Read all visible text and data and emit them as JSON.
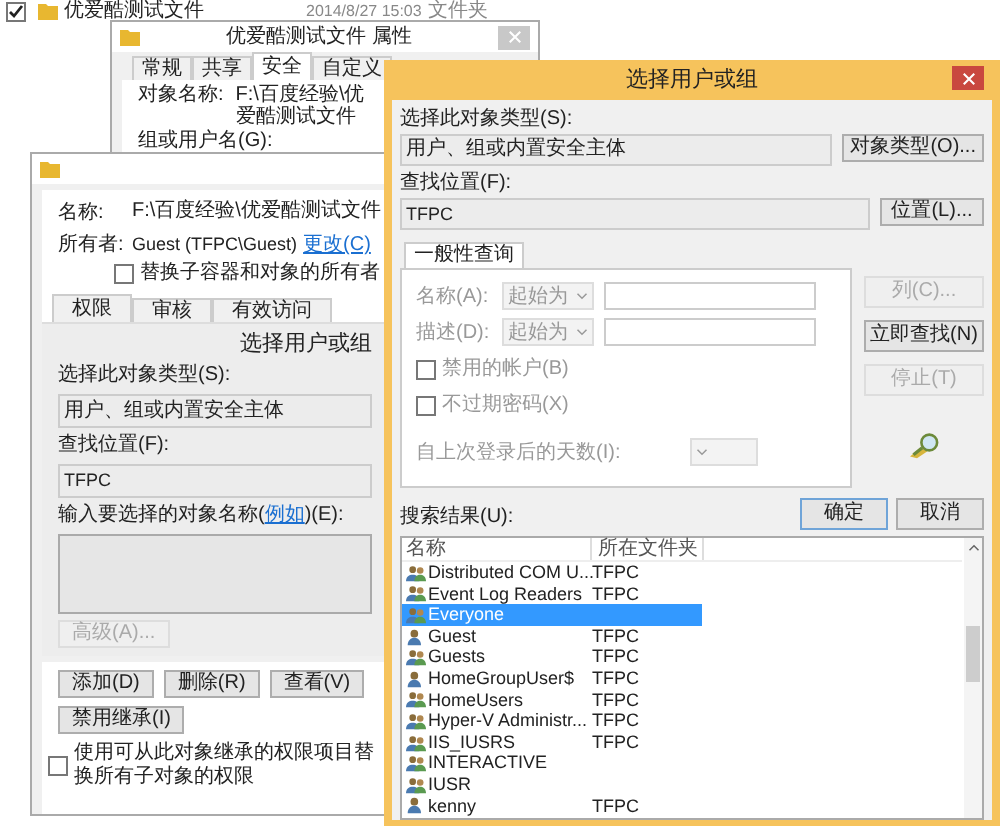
{
  "explorer_row": {
    "checked": true,
    "name": "优爱酷测试文件",
    "date": "2014/8/27 15:03",
    "type": "文件夹"
  },
  "properties_window": {
    "title": "优爱酷测试文件 属性",
    "tabs": [
      {
        "label": "常规",
        "selected": false
      },
      {
        "label": "共享",
        "selected": false
      },
      {
        "label": "安全",
        "selected": true
      },
      {
        "label": "自定义",
        "selected": false
      }
    ],
    "object_label": "对象名称:",
    "object_value": "F:\\百度经验\\优爱酷测试文件",
    "group_label": "组或用户名(G):"
  },
  "advanced_window": {
    "name_label": "名称:",
    "name_value": "F:\\百度经验\\优爱酷测试文件",
    "owner_label": "所有者:",
    "owner_value": "Guest (TFPC\\Guest)",
    "owner_link": "更改(C)",
    "replace_owner": {
      "label": "替换子容器和对象的所有者",
      "checked": false
    },
    "tabs": [
      {
        "label": "权限",
        "selected": true
      },
      {
        "label": "审核",
        "selected": false
      },
      {
        "label": "有效访问",
        "selected": false
      }
    ],
    "embedded": {
      "title": "选择用户或组",
      "type_label": "选择此对象类型(S):",
      "type_value": "用户、组或内置安全主体",
      "location_label": "查找位置(F):",
      "location_value": "TFPC",
      "names_before": "输入要选择的对象名称(",
      "names_link": "例如",
      "names_after": ")(E):",
      "advanced_button": {
        "label": "高级(A)...",
        "disabled": true
      }
    },
    "buttons": [
      "添加(D)",
      "删除(R)",
      "查看(V)"
    ],
    "disable_inheritance": "禁用继承(I)",
    "replace_permissions": {
      "label": "使用可从此对象继承的权限项目替换所有子对象的权限",
      "checked": false
    }
  },
  "dialog": {
    "title": "选择用户或组",
    "type_label": "选择此对象类型(S):",
    "type_value": "用户、组或内置安全主体",
    "type_button": "对象类型(O)...",
    "location_label": "查找位置(F):",
    "location_value": "TFPC",
    "location_button": "位置(L)...",
    "query": {
      "tab": "一般性查询",
      "disabled": true,
      "rows": [
        {
          "label": "名称(A):",
          "mode": "起始为"
        },
        {
          "label": "描述(D):",
          "mode": "起始为"
        }
      ],
      "checkboxes": [
        {
          "label": "禁用的帐户(B)",
          "checked": false
        },
        {
          "label": "不过期密码(X)",
          "checked": false
        }
      ],
      "days_label": "自上次登录后的天数(I):"
    },
    "side_buttons": [
      {
        "label": "列(C)...",
        "disabled": true
      },
      {
        "label": "立即查找(N)",
        "disabled": false
      },
      {
        "label": "停止(T)",
        "disabled": true
      }
    ],
    "ok": "确定",
    "cancel": "取消",
    "results_label": "搜索结果(U):",
    "columns": [
      "名称",
      "所在文件夹"
    ],
    "rows": [
      {
        "kind": "group",
        "name": "Distributed COM U...",
        "folder": "TFPC",
        "selected": false
      },
      {
        "kind": "group",
        "name": "Event Log Readers",
        "folder": "TFPC",
        "selected": false
      },
      {
        "kind": "group",
        "name": "Everyone",
        "selected": true
      },
      {
        "kind": "user",
        "name": "Guest",
        "folder": "TFPC",
        "selected": false
      },
      {
        "kind": "group",
        "name": "Guests",
        "folder": "TFPC",
        "selected": false
      },
      {
        "kind": "user",
        "name": "HomeGroupUser$",
        "folder": "TFPC",
        "selected": false
      },
      {
        "kind": "group",
        "name": "HomeUsers",
        "folder": "TFPC",
        "selected": false
      },
      {
        "kind": "group",
        "name": "Hyper-V Administr...",
        "folder": "TFPC",
        "selected": false
      },
      {
        "kind": "group",
        "name": "IIS_IUSRS",
        "folder": "TFPC",
        "selected": false
      },
      {
        "kind": "group",
        "name": "INTERACTIVE",
        "selected": false
      },
      {
        "kind": "group",
        "name": "IUSR",
        "selected": false
      },
      {
        "kind": "user",
        "name": "kenny",
        "folder": "TFPC",
        "selected": false
      }
    ]
  }
}
